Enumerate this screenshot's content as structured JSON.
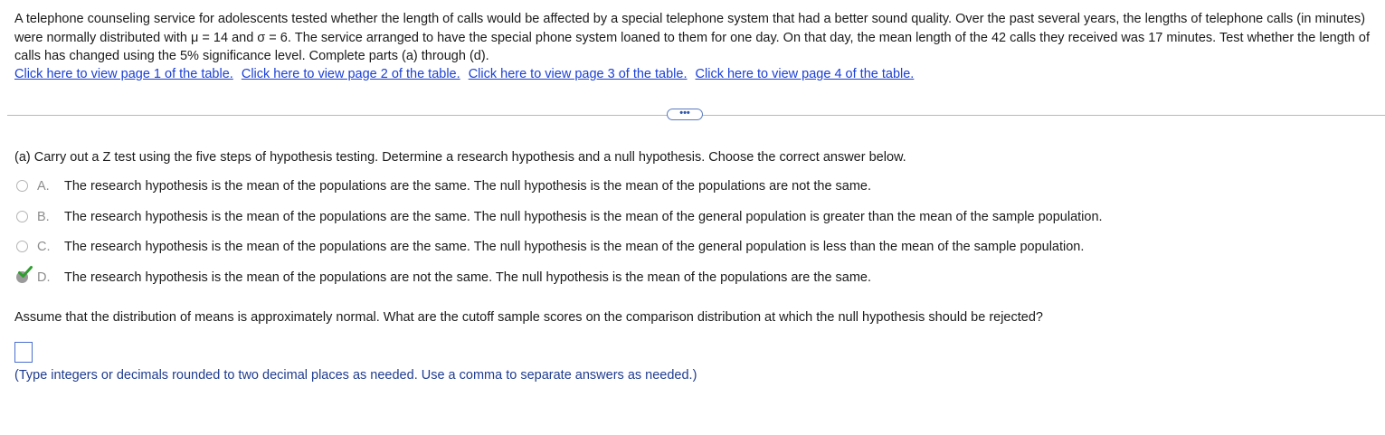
{
  "problem": {
    "text_part1": "A telephone counseling service for adolescents tested whether the length of calls would be affected by a special telephone system that had a better sound quality. Over the past several years, the lengths of telephone calls (in minutes) were normally distributed with ",
    "mu_symbol": "μ",
    "mu_value": " = 14 and ",
    "sigma_symbol": "σ",
    "sigma_value": " = 6",
    "text_part2": ". The service arranged to have the special phone system loaned to them for one day. On that day, the mean length of the 42 calls they received was 17 minutes. Test whether the length of calls has changed using the 5% significance level. Complete parts (a) through (d)."
  },
  "links": [
    "Click here to view page 1 of the table.",
    "Click here to view page 2 of the table.",
    "Click here to view page 3 of the table.",
    "Click here to view page 4 of the table."
  ],
  "expand_button": "•••",
  "part_a": {
    "prompt": "(a) Carry out a Z test using the five steps of hypothesis testing. Determine a research hypothesis and a null hypothesis. Choose the correct answer below.",
    "selected": "D",
    "selected_color": "#2e9e2e",
    "options": [
      {
        "letter": "A.",
        "text": "The research hypothesis is the mean of the populations are the same. The null hypothesis is the mean of the populations are not the same."
      },
      {
        "letter": "B.",
        "text": "The research hypothesis is the mean of the populations are the same. The null hypothesis is the mean of the general population is greater than the mean of the sample population."
      },
      {
        "letter": "C.",
        "text": "The research hypothesis is the mean of the populations are the same. The null hypothesis is the mean of the general population is less than the mean of the sample population."
      },
      {
        "letter": "D.",
        "text": "The research hypothesis is the mean of the populations are not the same. The null hypothesis is the mean of the populations are the same."
      }
    ]
  },
  "question2": {
    "prompt": "Assume that the distribution of means is approximately normal. What are the cutoff sample scores on the comparison distribution at which the null hypothesis should be rejected?",
    "answer_value": "",
    "hint": "(Type integers or decimals rounded to two decimal places as needed. Use a comma to separate answers as needed.)"
  },
  "colors": {
    "link": "#1a3fd6",
    "hint": "#1f3c8f",
    "input_border": "#4b6fd0"
  }
}
